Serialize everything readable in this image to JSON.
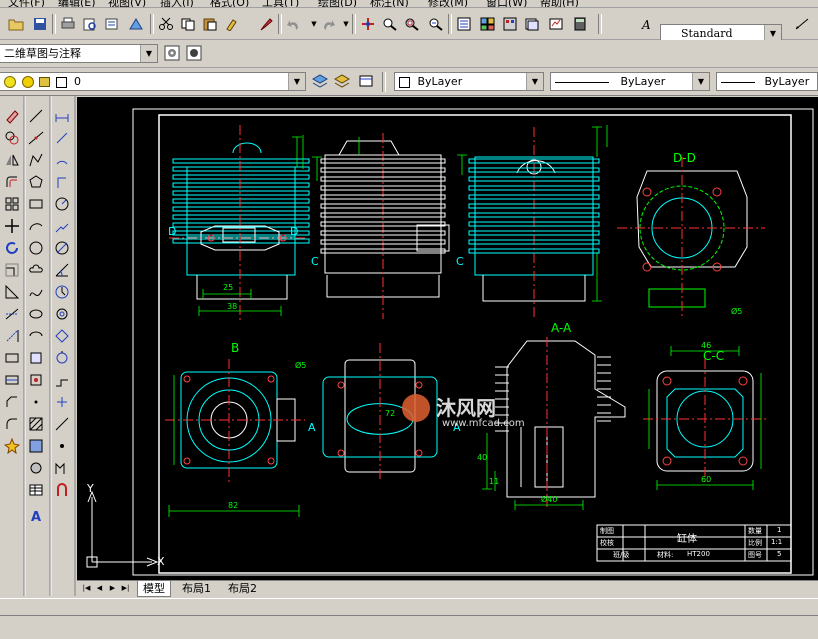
{
  "menu": [
    "文件(F)",
    "编辑(E)",
    "视图(V)",
    "插入(I)",
    "格式(O)",
    "工具(T)",
    "绘图(D)",
    "标注(N)",
    "修改(M)",
    "窗口(W)",
    "帮助(H)"
  ],
  "toolbar": {
    "text_style": "Standard"
  },
  "workspace": {
    "name": "二维草图与注释"
  },
  "layers": {
    "current_layer": "0",
    "color": "ByLayer",
    "linetype": "ByLayer",
    "lineweight": "ByLayer"
  },
  "drawing": {
    "section_labels": [
      "D-D",
      "B",
      "A-A",
      "C-C"
    ],
    "cut_markers": [
      "D",
      "D",
      "C",
      "C",
      "A",
      "A"
    ],
    "dims": [
      "25",
      "38",
      "82",
      "72",
      "Ø40",
      "60",
      "46",
      "40",
      "11",
      "Ø5",
      "Ø5"
    ],
    "title_block": {
      "part_name": "缸体",
      "material": "HT200",
      "drawing_label": "制图",
      "check_label": "校核",
      "qty_label": "数量",
      "qty_value": "1",
      "scale_label": "比例",
      "scale_value": "1:1",
      "sheet_label": "图号",
      "sheet_value": "5",
      "material_label": "材料:",
      "class_label": "班/级"
    },
    "axis_y": "Y",
    "axis_x": "X"
  },
  "watermark": {
    "brand": "沐风网",
    "url": "www.mfcad.com"
  },
  "tabs": [
    "模型",
    "布局1",
    "布局2"
  ],
  "active_tab": "模型",
  "colors": {
    "canvas": "#000000",
    "cyan_lines": "#00ffff",
    "white_lines": "#ffffff",
    "center_lines": "#ff0000",
    "dims": "#00ff00",
    "window": "#d4d0c8"
  }
}
